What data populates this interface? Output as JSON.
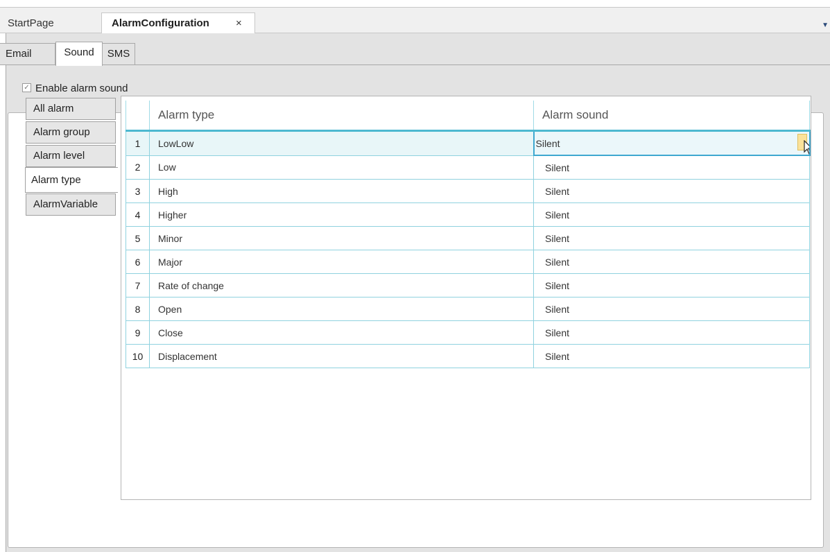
{
  "doc_tabs": {
    "start": "StartPage",
    "active": "AlarmConfiguration",
    "close": "×"
  },
  "sub_tabs": [
    "Email",
    "Sound",
    "SMS"
  ],
  "enable_sound": {
    "label": "Enable alarm sound",
    "checked": true,
    "check_glyph": "✓"
  },
  "categories": [
    "All alarm",
    "Alarm group",
    "Alarm level",
    "Alarm type",
    "AlarmVariable"
  ],
  "active_category": "Alarm type",
  "table": {
    "columns": [
      "Alarm type",
      "Alarm sound"
    ],
    "rows": [
      {
        "index": "1",
        "type": "LowLow",
        "sound": "Silent"
      },
      {
        "index": "2",
        "type": "Low",
        "sound": "Silent"
      },
      {
        "index": "3",
        "type": "High",
        "sound": "Silent"
      },
      {
        "index": "4",
        "type": "Higher",
        "sound": "Silent"
      },
      {
        "index": "5",
        "type": "Minor",
        "sound": "Silent"
      },
      {
        "index": "6",
        "type": "Major",
        "sound": "Silent"
      },
      {
        "index": "7",
        "type": "Rate of change",
        "sound": "Silent"
      },
      {
        "index": "8",
        "type": "Open",
        "sound": "Silent"
      },
      {
        "index": "9",
        "type": "Close",
        "sound": "Silent"
      },
      {
        "index": "10",
        "type": "Displacement",
        "sound": "Silent"
      }
    ]
  },
  "colors": {
    "accent": "#4cb8d0",
    "grid_line": "#8fd2df",
    "dropdown": "#fbe29a"
  }
}
